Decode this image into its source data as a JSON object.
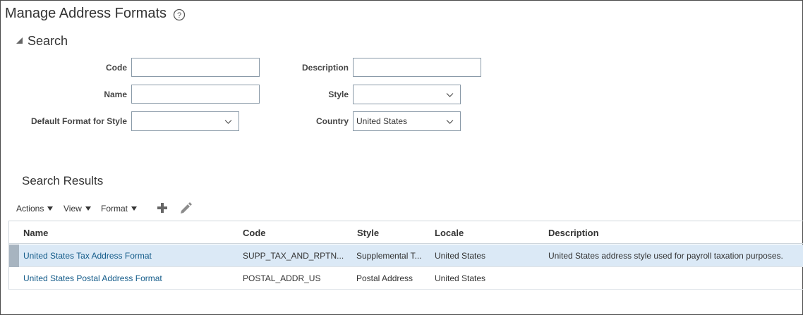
{
  "page": {
    "title": "Manage Address Formats",
    "help_icon": "help-circle-icon"
  },
  "search": {
    "header": "Search",
    "fields": {
      "code": {
        "label": "Code",
        "value": ""
      },
      "description": {
        "label": "Description",
        "value": ""
      },
      "name": {
        "label": "Name",
        "value": ""
      },
      "style": {
        "label": "Style",
        "value": ""
      },
      "default_format": {
        "label": "Default Format for Style",
        "value": ""
      },
      "country": {
        "label": "Country",
        "value": "United States"
      }
    }
  },
  "results": {
    "title": "Search Results",
    "toolbar": {
      "actions": "Actions",
      "view": "View",
      "format": "Format",
      "add_icon": "plus-icon",
      "edit_icon": "pencil-icon"
    },
    "columns": [
      "Name",
      "Code",
      "Style",
      "Locale",
      "Description"
    ],
    "rows": [
      {
        "name": "United States Tax Address Format",
        "code": "SUPP_TAX_AND_RPTN...",
        "style": "Supplemental T...",
        "locale": "United States",
        "description": "United States address style used for payroll taxation purposes.",
        "selected": true
      },
      {
        "name": "United States Postal Address Format",
        "code": "POSTAL_ADDR_US",
        "style": "Postal Address",
        "locale": "United States",
        "description": "",
        "selected": false
      }
    ]
  },
  "colors": {
    "link": "#145c8a",
    "selected_row": "#dbe9f6",
    "border": "#8a9aa8"
  }
}
